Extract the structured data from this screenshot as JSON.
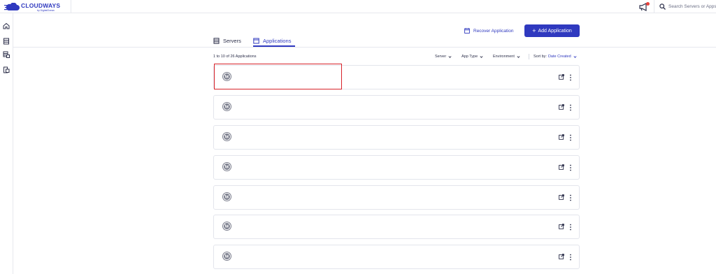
{
  "brand": {
    "name": "CLOUDWAYS",
    "sub": "by DigitalOcean",
    "color": "#2f39bf"
  },
  "header": {
    "search_placeholder": "Search Servers or Apps",
    "notification_icon": "megaphone-icon",
    "has_notification": true
  },
  "sidebar": {
    "items": [
      {
        "icon": "home-icon"
      },
      {
        "icon": "servers-icon"
      },
      {
        "icon": "applications-icon"
      },
      {
        "icon": "add-ons-icon"
      }
    ]
  },
  "tabs": [
    {
      "label": "Servers",
      "active": false
    },
    {
      "label": "Applications",
      "active": true
    }
  ],
  "actions": {
    "recover_label": "Recover Application",
    "add_label": "Add Application",
    "add_icon": "+"
  },
  "toolbar": {
    "count_text": "1 to 10 of 26 Applications",
    "filters": [
      {
        "label": "Server"
      },
      {
        "label": "App Type"
      },
      {
        "label": "Environment"
      }
    ],
    "sort_label": "Sort by:",
    "sort_value": "Date Created"
  },
  "applications": [
    {
      "name": "",
      "server": "",
      "project": "",
      "created": ""
    },
    {
      "name": "",
      "server": "",
      "project": "",
      "created": ""
    },
    {
      "name": "",
      "server": "",
      "project": "",
      "created": ""
    },
    {
      "name": "",
      "server": "",
      "project": "",
      "created": ""
    },
    {
      "name": "",
      "server": "",
      "project": "",
      "created": ""
    },
    {
      "name": "",
      "server": "",
      "project": "",
      "created": ""
    },
    {
      "name": "",
      "server": "",
      "project": "",
      "created": ""
    }
  ],
  "colors": {
    "accent": "#2f39bf",
    "highlight": "#d8232a",
    "notification": "#e8413b"
  }
}
